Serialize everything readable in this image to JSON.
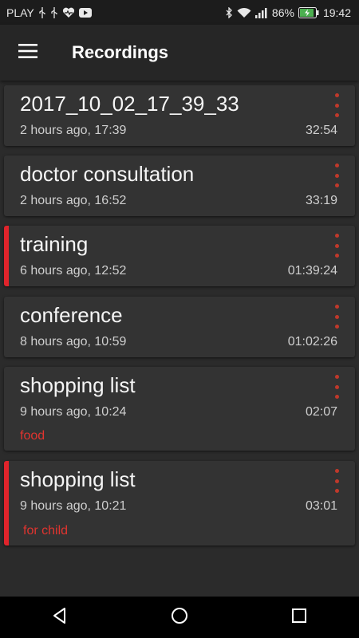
{
  "status_bar": {
    "carrier": "PLAY",
    "battery": "86%",
    "time": "19:42",
    "left_icons": [
      "usb-icon",
      "usb-icon",
      "health-icon",
      "youtube-icon"
    ],
    "right_icons": [
      "bluetooth-icon",
      "wifi-icon",
      "signal-icon",
      "battery-charging-icon"
    ]
  },
  "app_bar": {
    "title": "Recordings",
    "menu_icon": "menu-icon"
  },
  "colors": {
    "accent": "#e0242b",
    "background": "#2b2b2b",
    "card": "#333333"
  },
  "recordings": [
    {
      "title": "2017_10_02_17_39_33",
      "meta": "2 hours ago, 17:39",
      "duration": "32:54",
      "tag": "",
      "marked": false
    },
    {
      "title": "doctor consultation",
      "meta": "2 hours ago, 16:52",
      "duration": "33:19",
      "tag": "",
      "marked": false
    },
    {
      "title": "training",
      "meta": "6 hours ago, 12:52",
      "duration": "01:39:24",
      "tag": "",
      "marked": true
    },
    {
      "title": "conference",
      "meta": "8 hours ago, 10:59",
      "duration": "01:02:26",
      "tag": "",
      "marked": false
    },
    {
      "title": "shopping list",
      "meta": "9 hours ago, 10:24",
      "duration": "02:07",
      "tag": "food",
      "marked": false
    },
    {
      "title": "shopping list",
      "meta": "9 hours ago, 10:21",
      "duration": "03:01",
      "tag": "for child",
      "marked": true
    }
  ],
  "nav_bar": {
    "icons": [
      "back-icon",
      "home-icon",
      "recents-icon"
    ]
  }
}
